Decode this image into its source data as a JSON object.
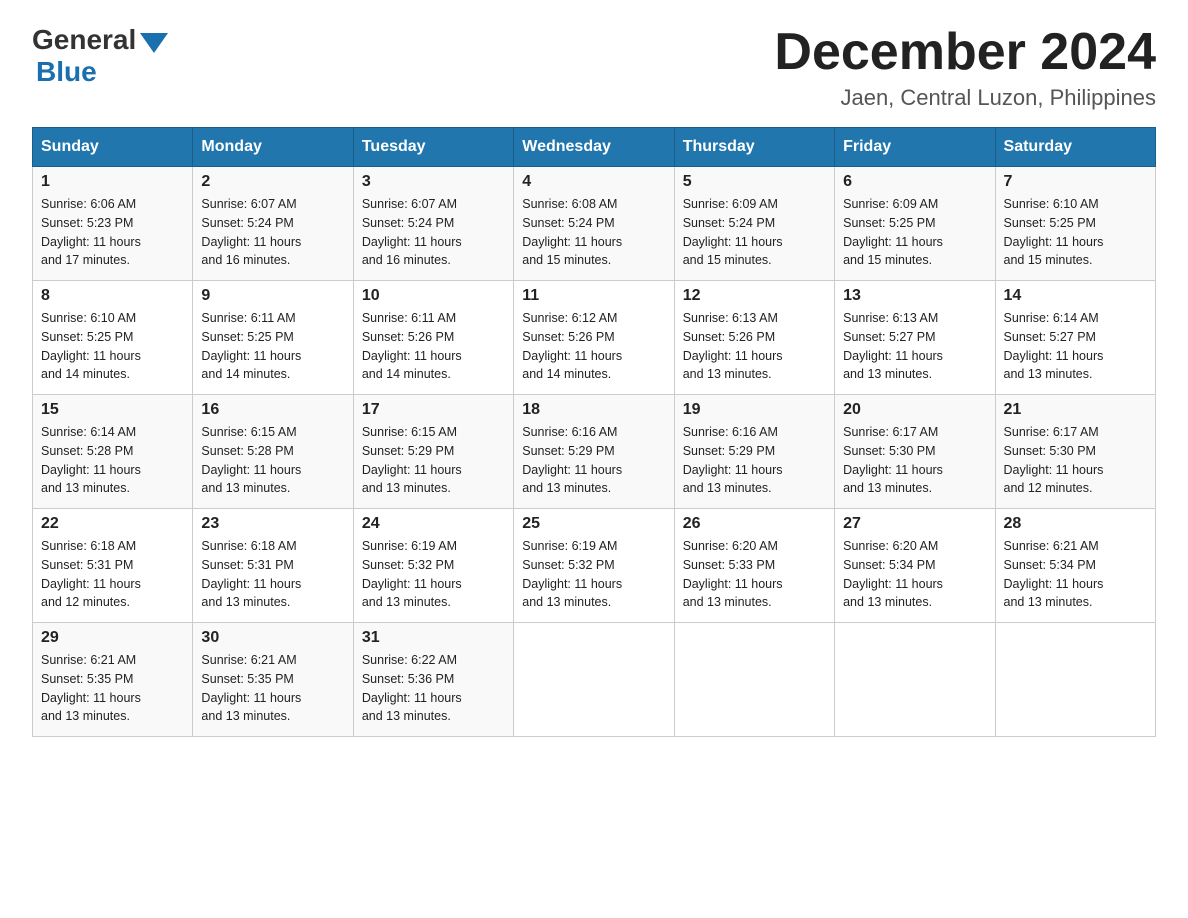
{
  "header": {
    "logo_general": "General",
    "logo_blue": "Blue",
    "month_year": "December 2024",
    "location": "Jaen, Central Luzon, Philippines"
  },
  "days_of_week": [
    "Sunday",
    "Monday",
    "Tuesday",
    "Wednesday",
    "Thursday",
    "Friday",
    "Saturday"
  ],
  "weeks": [
    [
      {
        "day": "1",
        "sunrise": "6:06 AM",
        "sunset": "5:23 PM",
        "daylight": "11 hours and 17 minutes."
      },
      {
        "day": "2",
        "sunrise": "6:07 AM",
        "sunset": "5:24 PM",
        "daylight": "11 hours and 16 minutes."
      },
      {
        "day": "3",
        "sunrise": "6:07 AM",
        "sunset": "5:24 PM",
        "daylight": "11 hours and 16 minutes."
      },
      {
        "day": "4",
        "sunrise": "6:08 AM",
        "sunset": "5:24 PM",
        "daylight": "11 hours and 15 minutes."
      },
      {
        "day": "5",
        "sunrise": "6:09 AM",
        "sunset": "5:24 PM",
        "daylight": "11 hours and 15 minutes."
      },
      {
        "day": "6",
        "sunrise": "6:09 AM",
        "sunset": "5:25 PM",
        "daylight": "11 hours and 15 minutes."
      },
      {
        "day": "7",
        "sunrise": "6:10 AM",
        "sunset": "5:25 PM",
        "daylight": "11 hours and 15 minutes."
      }
    ],
    [
      {
        "day": "8",
        "sunrise": "6:10 AM",
        "sunset": "5:25 PM",
        "daylight": "11 hours and 14 minutes."
      },
      {
        "day": "9",
        "sunrise": "6:11 AM",
        "sunset": "5:25 PM",
        "daylight": "11 hours and 14 minutes."
      },
      {
        "day": "10",
        "sunrise": "6:11 AM",
        "sunset": "5:26 PM",
        "daylight": "11 hours and 14 minutes."
      },
      {
        "day": "11",
        "sunrise": "6:12 AM",
        "sunset": "5:26 PM",
        "daylight": "11 hours and 14 minutes."
      },
      {
        "day": "12",
        "sunrise": "6:13 AM",
        "sunset": "5:26 PM",
        "daylight": "11 hours and 13 minutes."
      },
      {
        "day": "13",
        "sunrise": "6:13 AM",
        "sunset": "5:27 PM",
        "daylight": "11 hours and 13 minutes."
      },
      {
        "day": "14",
        "sunrise": "6:14 AM",
        "sunset": "5:27 PM",
        "daylight": "11 hours and 13 minutes."
      }
    ],
    [
      {
        "day": "15",
        "sunrise": "6:14 AM",
        "sunset": "5:28 PM",
        "daylight": "11 hours and 13 minutes."
      },
      {
        "day": "16",
        "sunrise": "6:15 AM",
        "sunset": "5:28 PM",
        "daylight": "11 hours and 13 minutes."
      },
      {
        "day": "17",
        "sunrise": "6:15 AM",
        "sunset": "5:29 PM",
        "daylight": "11 hours and 13 minutes."
      },
      {
        "day": "18",
        "sunrise": "6:16 AM",
        "sunset": "5:29 PM",
        "daylight": "11 hours and 13 minutes."
      },
      {
        "day": "19",
        "sunrise": "6:16 AM",
        "sunset": "5:29 PM",
        "daylight": "11 hours and 13 minutes."
      },
      {
        "day": "20",
        "sunrise": "6:17 AM",
        "sunset": "5:30 PM",
        "daylight": "11 hours and 13 minutes."
      },
      {
        "day": "21",
        "sunrise": "6:17 AM",
        "sunset": "5:30 PM",
        "daylight": "11 hours and 12 minutes."
      }
    ],
    [
      {
        "day": "22",
        "sunrise": "6:18 AM",
        "sunset": "5:31 PM",
        "daylight": "11 hours and 12 minutes."
      },
      {
        "day": "23",
        "sunrise": "6:18 AM",
        "sunset": "5:31 PM",
        "daylight": "11 hours and 13 minutes."
      },
      {
        "day": "24",
        "sunrise": "6:19 AM",
        "sunset": "5:32 PM",
        "daylight": "11 hours and 13 minutes."
      },
      {
        "day": "25",
        "sunrise": "6:19 AM",
        "sunset": "5:32 PM",
        "daylight": "11 hours and 13 minutes."
      },
      {
        "day": "26",
        "sunrise": "6:20 AM",
        "sunset": "5:33 PM",
        "daylight": "11 hours and 13 minutes."
      },
      {
        "day": "27",
        "sunrise": "6:20 AM",
        "sunset": "5:34 PM",
        "daylight": "11 hours and 13 minutes."
      },
      {
        "day": "28",
        "sunrise": "6:21 AM",
        "sunset": "5:34 PM",
        "daylight": "11 hours and 13 minutes."
      }
    ],
    [
      {
        "day": "29",
        "sunrise": "6:21 AM",
        "sunset": "5:35 PM",
        "daylight": "11 hours and 13 minutes."
      },
      {
        "day": "30",
        "sunrise": "6:21 AM",
        "sunset": "5:35 PM",
        "daylight": "11 hours and 13 minutes."
      },
      {
        "day": "31",
        "sunrise": "6:22 AM",
        "sunset": "5:36 PM",
        "daylight": "11 hours and 13 minutes."
      },
      null,
      null,
      null,
      null
    ]
  ],
  "labels": {
    "sunrise": "Sunrise:",
    "sunset": "Sunset:",
    "daylight": "Daylight:"
  }
}
